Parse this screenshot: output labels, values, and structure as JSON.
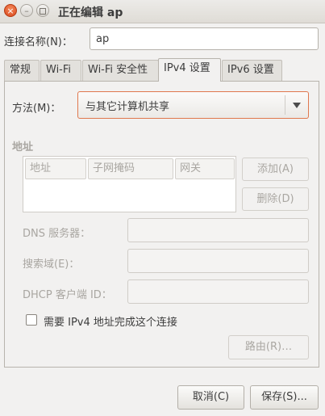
{
  "window": {
    "title": "正在编辑 ap",
    "close_glyph": "×",
    "min_glyph": "–"
  },
  "connection": {
    "label": "连接名称(N)：",
    "value": "ap"
  },
  "tabs": [
    {
      "label": "常规"
    },
    {
      "label": "Wi-Fi"
    },
    {
      "label": "Wi-Fi 安全性"
    },
    {
      "label": "IPv4 设置"
    },
    {
      "label": "IPv6 设置"
    }
  ],
  "method": {
    "label": "方法(M)：",
    "value": "与其它计算机共享"
  },
  "address": {
    "section": "地址",
    "columns": [
      "地址",
      "子网掩码",
      "网关"
    ],
    "add_button": "添加(A)",
    "delete_button": "删除(D)"
  },
  "dns": {
    "label": "DNS 服务器：",
    "value": ""
  },
  "search_domain": {
    "label": "搜索域(E)：",
    "value": ""
  },
  "dhcp_client_id": {
    "label": "DHCP 客户端 ID：",
    "value": ""
  },
  "require_ipv4": {
    "label": "需要 IPv4 地址完成这个连接",
    "checked": false
  },
  "routes_button": "路由(R)…",
  "footer": {
    "cancel": "取消(C)",
    "save": "保存(S)..."
  }
}
